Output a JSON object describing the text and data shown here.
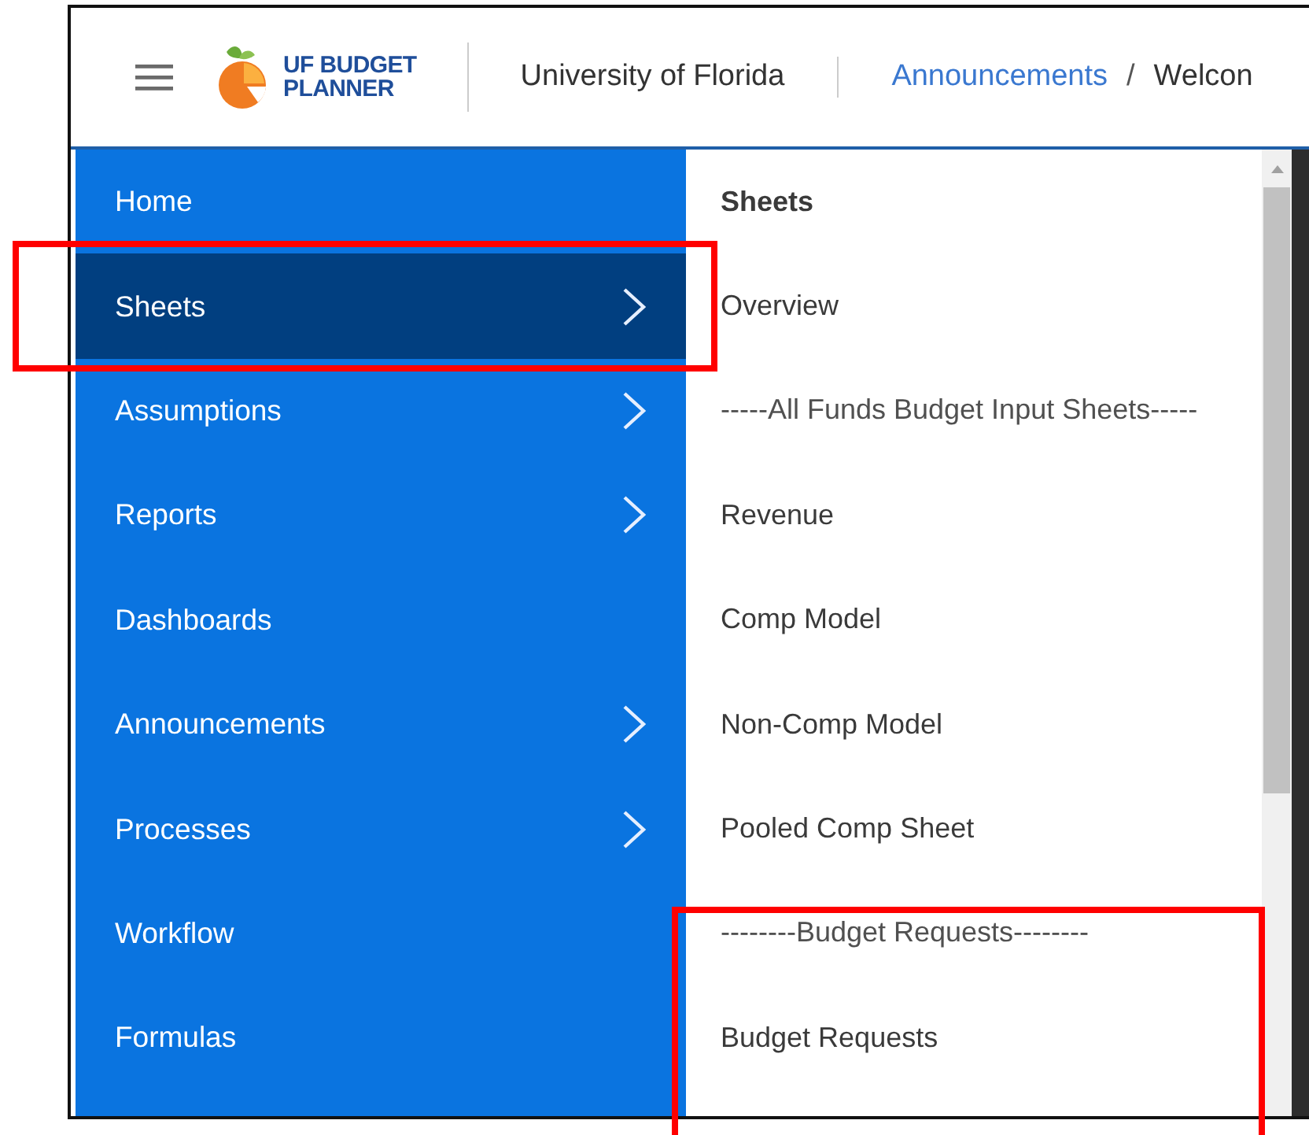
{
  "header": {
    "logo_lines": [
      "UF BUDGET",
      "PLANNER"
    ],
    "organization": "University of Florida",
    "breadcrumb_separator": "/",
    "breadcrumb": [
      {
        "label": "Announcements",
        "kind": "link"
      },
      {
        "label": "Welcon",
        "kind": "current"
      }
    ]
  },
  "menu": {
    "items": [
      {
        "label": "Home",
        "has_submenu": false,
        "selected": false
      },
      {
        "label": "Sheets",
        "has_submenu": true,
        "selected": true
      },
      {
        "label": "Assumptions",
        "has_submenu": true,
        "selected": false
      },
      {
        "label": "Reports",
        "has_submenu": true,
        "selected": false
      },
      {
        "label": "Dashboards",
        "has_submenu": false,
        "selected": false
      },
      {
        "label": "Announcements",
        "has_submenu": true,
        "selected": false
      },
      {
        "label": "Processes",
        "has_submenu": true,
        "selected": false
      },
      {
        "label": "Workflow",
        "has_submenu": false,
        "selected": false
      },
      {
        "label": "Formulas",
        "has_submenu": false,
        "selected": false
      }
    ]
  },
  "submenu": {
    "title": "Sheets",
    "items": [
      {
        "label": "Overview",
        "kind": "link"
      },
      {
        "label": "-----All Funds Budget Input Sheets-----",
        "kind": "separator"
      },
      {
        "label": "Revenue",
        "kind": "link"
      },
      {
        "label": "Comp Model",
        "kind": "link"
      },
      {
        "label": "Non-Comp Model",
        "kind": "link"
      },
      {
        "label": "Pooled Comp Sheet",
        "kind": "link"
      },
      {
        "label": "--------Budget Requests--------",
        "kind": "separator"
      },
      {
        "label": "Budget Requests",
        "kind": "link"
      }
    ]
  }
}
